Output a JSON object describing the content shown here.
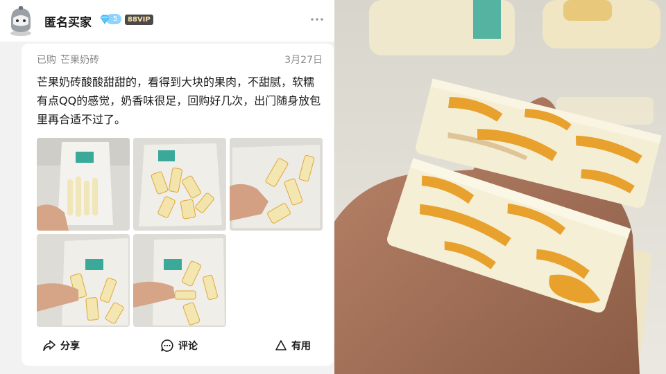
{
  "header": {
    "username": "匿名买家",
    "level": "5",
    "vip_badge": "88VIP",
    "more_icon": "more-dots-icon"
  },
  "review_card": {
    "purchased_label": "已购",
    "product_name": "芒果奶砖",
    "date": "3月27日",
    "text": "芒果奶砖酸酸甜甜的，看得到大块的果肉，不甜腻，软糯有点QQ的感觉，奶香味很足，回购好几次，出门随身放包里再合适不过了。",
    "photo_count": 5
  },
  "actions": {
    "share_label": "分享",
    "comment_label": "评论",
    "useful_label": "有用"
  },
  "colors": {
    "page_bg": "#f2f2f2",
    "card_bg": "#ffffff",
    "muted_text": "#8a8a8a",
    "level_badge": "#8fd3ff",
    "vip_badge_bg": "#4a4a4a",
    "vip_badge_text": "#ffe1a6",
    "mango": "#e6a02a",
    "milk_brick": "#f3ecd2"
  }
}
